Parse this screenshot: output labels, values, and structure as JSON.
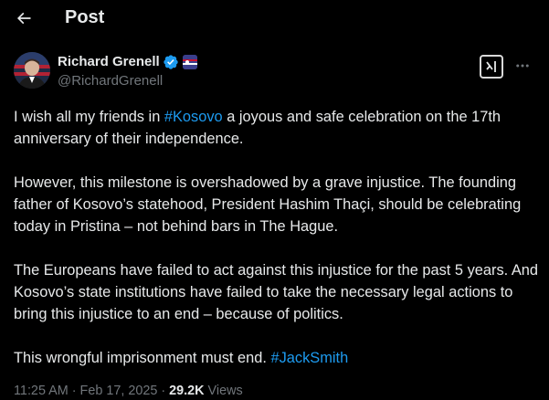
{
  "header": {
    "back_icon": "arrow-left-icon",
    "title": "Post"
  },
  "author": {
    "display_name": "Richard Grenell",
    "handle": "@RichardGrenell",
    "verified_icon": "verified-badge-icon",
    "verified_color": "#1d9bf0",
    "affiliation_icon": "affiliation-badge-icon"
  },
  "actions": {
    "grok_icon": "grok-icon",
    "more_icon": "more-horizontal-icon"
  },
  "post": {
    "p1_before": "I wish all my friends in ",
    "p1_hashtag": "#Kosovo",
    "p1_after": " a joyous and safe celebration on the 17th anniversary of their independence.",
    "p2": "However, this milestone is overshadowed by a grave injustice. The founding father of Kosovo’s statehood, President Hashim Thaçi, should be celebrating today in Pristina – not behind bars in The Hague.",
    "p3": "The Europeans have failed to act against this injustice for the past 5 years. And Kosovo’s state institutions have failed to take the necessary legal actions to bring this injustice to an end – because of politics.",
    "p4_before": "This wrongful imprisonment must end. ",
    "p4_hashtag": "#JackSmith"
  },
  "meta": {
    "time": "11:25 AM",
    "separator": " · ",
    "date": "Feb 17, 2025",
    "views_count": "29.2K",
    "views_label": " Views"
  },
  "colors": {
    "background": "#000000",
    "text": "#e7e9ea",
    "muted": "#71767b",
    "link": "#1d9bf0"
  }
}
